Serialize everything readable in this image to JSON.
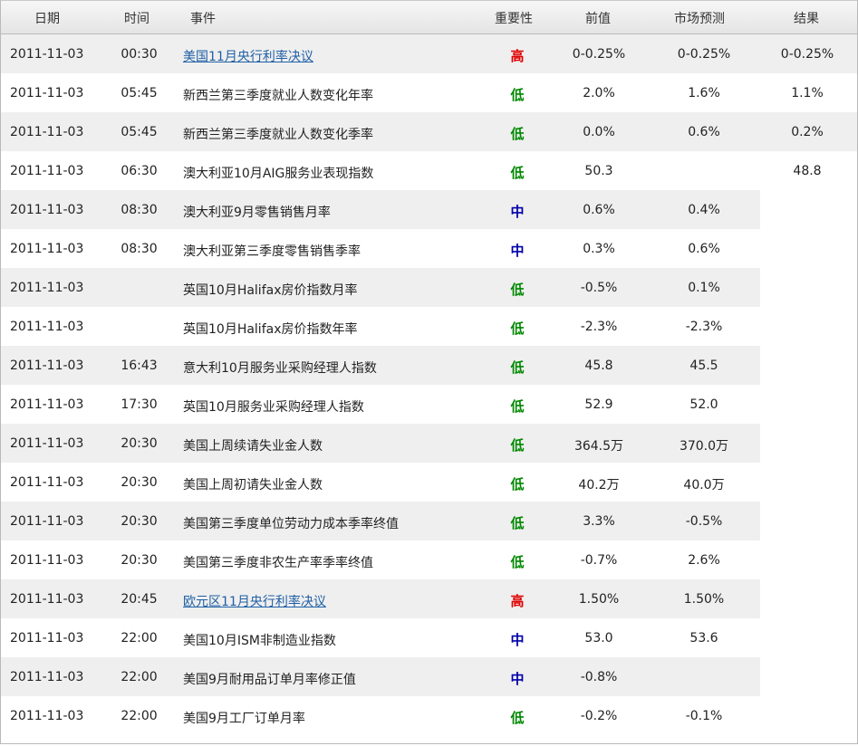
{
  "headers": {
    "date": "日期",
    "time": "时间",
    "event": "事件",
    "importance": "重要性",
    "previous": "前值",
    "forecast": "市场预测",
    "result": "结果"
  },
  "importance_colors": {
    "高": "#e00000",
    "中": "#0000aa",
    "低": "#008800"
  },
  "rows": [
    {
      "date": "2011-11-03",
      "time": "00:30",
      "event": "美国11月央行利率决议",
      "link": true,
      "importance": "高",
      "previous": "0-0.25%",
      "forecast": "0-0.25%",
      "result": "0-0.25%"
    },
    {
      "date": "2011-11-03",
      "time": "05:45",
      "event": "新西兰第三季度就业人数变化年率",
      "link": false,
      "importance": "低",
      "previous": "2.0%",
      "forecast": "1.6%",
      "result": "1.1%"
    },
    {
      "date": "2011-11-03",
      "time": "05:45",
      "event": "新西兰第三季度就业人数变化季率",
      "link": false,
      "importance": "低",
      "previous": "0.0%",
      "forecast": "0.6%",
      "result": "0.2%"
    },
    {
      "date": "2011-11-03",
      "time": "06:30",
      "event": "澳大利亚10月AIG服务业表现指数",
      "link": false,
      "importance": "低",
      "previous": "50.3",
      "forecast": "",
      "result": "48.8"
    },
    {
      "date": "2011-11-03",
      "time": "08:30",
      "event": "澳大利亚9月零售销售月率",
      "link": false,
      "importance": "中",
      "previous": "0.6%",
      "forecast": "0.4%",
      "result": ""
    },
    {
      "date": "2011-11-03",
      "time": "08:30",
      "event": "澳大利亚第三季度零售销售季率",
      "link": false,
      "importance": "中",
      "previous": "0.3%",
      "forecast": "0.6%",
      "result": ""
    },
    {
      "date": "2011-11-03",
      "time": "",
      "event": "英国10月Halifax房价指数月率",
      "link": false,
      "importance": "低",
      "previous": "-0.5%",
      "forecast": "0.1%",
      "result": ""
    },
    {
      "date": "2011-11-03",
      "time": "",
      "event": "英国10月Halifax房价指数年率",
      "link": false,
      "importance": "低",
      "previous": "-2.3%",
      "forecast": "-2.3%",
      "result": ""
    },
    {
      "date": "2011-11-03",
      "time": "16:43",
      "event": "意大利10月服务业采购经理人指数",
      "link": false,
      "importance": "低",
      "previous": "45.8",
      "forecast": "45.5",
      "result": ""
    },
    {
      "date": "2011-11-03",
      "time": "17:30",
      "event": "英国10月服务业采购经理人指数",
      "link": false,
      "importance": "低",
      "previous": "52.9",
      "forecast": "52.0",
      "result": ""
    },
    {
      "date": "2011-11-03",
      "time": "20:30",
      "event": "美国上周续请失业金人数",
      "link": false,
      "importance": "低",
      "previous": "364.5万",
      "forecast": "370.0万",
      "result": ""
    },
    {
      "date": "2011-11-03",
      "time": "20:30",
      "event": "美国上周初请失业金人数",
      "link": false,
      "importance": "低",
      "previous": "40.2万",
      "forecast": "40.0万",
      "result": ""
    },
    {
      "date": "2011-11-03",
      "time": "20:30",
      "event": "美国第三季度单位劳动力成本季率终值",
      "link": false,
      "importance": "低",
      "previous": "3.3%",
      "forecast": "-0.5%",
      "result": ""
    },
    {
      "date": "2011-11-03",
      "time": "20:30",
      "event": "美国第三季度非农生产率季率终值",
      "link": false,
      "importance": "低",
      "previous": "-0.7%",
      "forecast": "2.6%",
      "result": ""
    },
    {
      "date": "2011-11-03",
      "time": "20:45",
      "event": "欧元区11月央行利率决议",
      "link": true,
      "importance": "高",
      "previous": "1.50%",
      "forecast": "1.50%",
      "result": ""
    },
    {
      "date": "2011-11-03",
      "time": "22:00",
      "event": "美国10月ISM非制造业指数",
      "link": false,
      "importance": "中",
      "previous": "53.0",
      "forecast": "53.6",
      "result": ""
    },
    {
      "date": "2011-11-03",
      "time": "22:00",
      "event": "美国9月耐用品订单月率修正值",
      "link": false,
      "importance": "中",
      "previous": "-0.8%",
      "forecast": "",
      "result": ""
    },
    {
      "date": "2011-11-03",
      "time": "22:00",
      "event": "美国9月工厂订单月率",
      "link": false,
      "importance": "低",
      "previous": "-0.2%",
      "forecast": "-0.1%",
      "result": ""
    }
  ]
}
